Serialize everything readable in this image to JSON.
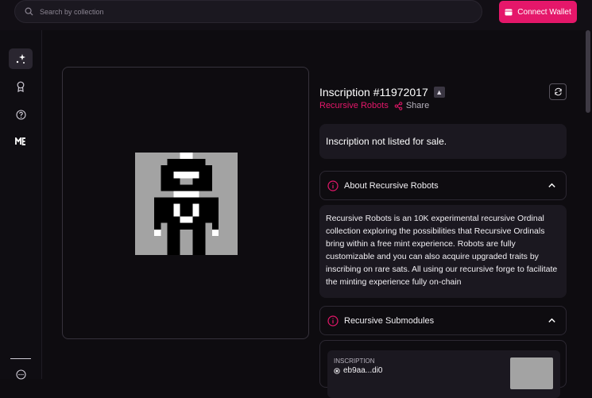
{
  "header": {
    "search_placeholder": "Search by collection",
    "connect_label": "Connect Wallet"
  },
  "sidebar": {
    "items": [
      {
        "name": "sparkles-icon",
        "active": true
      },
      {
        "name": "award-icon",
        "active": false
      },
      {
        "name": "help-icon",
        "active": false
      },
      {
        "name": "magic-eden-logo",
        "active": false
      },
      {
        "name": "more-icon",
        "active": false
      }
    ]
  },
  "inscription": {
    "title": "Inscription #11972017",
    "collection": "Recursive Robots",
    "share_label": "Share",
    "status": "Inscription not listed for sale."
  },
  "about": {
    "heading": "About Recursive Robots",
    "text": "Recursive Robots is an 10K experimental recursive Ordinal collection exploring the possibilities that Recursive Ordinals bring within a free mint experience. Robots are fully customizable and you can also acquire upgraded traits by inscribing on rare sats. All using our recursive forge to facilitate the minting experience fully on-chain"
  },
  "submodules": {
    "heading": "Recursive Submodules",
    "items": [
      {
        "label": "INSCRIPTION",
        "value": "eb9aa...di0"
      }
    ]
  },
  "colors": {
    "accent": "#e5176a",
    "background": "#0e0c10",
    "panel": "#1b1820"
  }
}
